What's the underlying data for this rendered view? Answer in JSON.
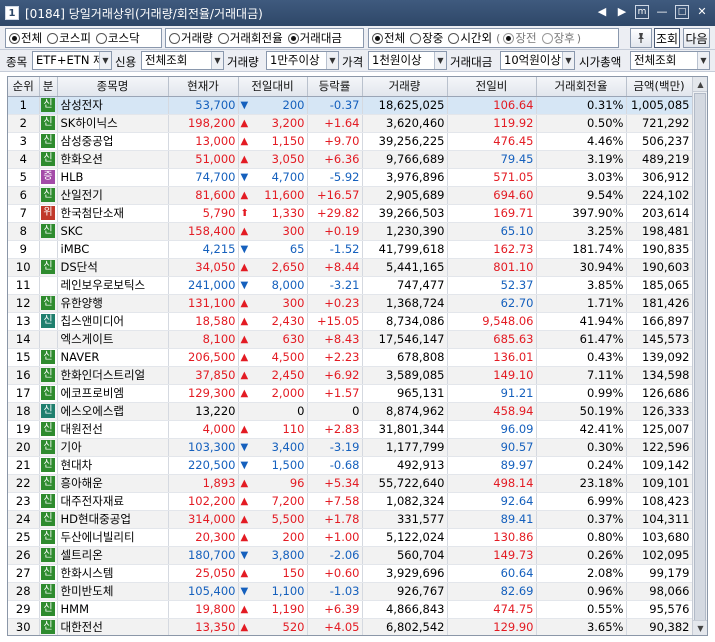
{
  "window": {
    "number": "1",
    "title": "[0184] 당일거래상위(거래량/회전율/거래대금)",
    "buttons": [
      "◀",
      "▶",
      "m",
      "—",
      "□",
      "✕"
    ]
  },
  "filters": {
    "market": {
      "options": [
        "전체",
        "코스피",
        "코스닥"
      ],
      "selected": "전체"
    },
    "sort": {
      "options": [
        "거래량",
        "거래회전율",
        "거래대금"
      ],
      "selected": "거래대금"
    },
    "session": {
      "options": [
        "전체",
        "장중",
        "시간외"
      ],
      "selected": "전체"
    },
    "after_hours": {
      "options": [
        "장전",
        "장후"
      ],
      "open": "(",
      "close": ")"
    },
    "pin_icon": "pin-icon",
    "search_button": "조회",
    "next_button": "다음",
    "row2": {
      "item_label": "종목",
      "item_value": "ETF+ETN 제",
      "credit_label": "신용",
      "credit_value": "전체조회",
      "volume_label": "거래량",
      "volume_value": "1만주이상",
      "price_label": "가격",
      "price_value": "1천원이상",
      "amount_label": "거래대금",
      "amount_value": "10억원이상",
      "cap_label": "시가총액",
      "cap_value": "전체조회"
    }
  },
  "table": {
    "headers": [
      "순위",
      "분",
      "종목명",
      "현재가",
      "전일대비",
      "등락률",
      "거래량",
      "전일비",
      "거래회전율",
      "금액(백만)"
    ],
    "rows": [
      {
        "rank": "1",
        "badge": "신",
        "badge_color": "green",
        "name": "삼성전자",
        "price": "53,700",
        "dir": "down",
        "change": "200",
        "rate": "-0.37",
        "volume": "18,625,025",
        "prev_ratio": "106.64",
        "turnover": "0.31%",
        "amount": "1,005,085",
        "selected": true
      },
      {
        "rank": "2",
        "badge": "신",
        "badge_color": "green",
        "name": "SK하이닉스",
        "price": "198,200",
        "dir": "up",
        "change": "3,200",
        "rate": "+1.64",
        "volume": "3,620,460",
        "prev_ratio": "119.92",
        "turnover": "0.50%",
        "amount": "721,292"
      },
      {
        "rank": "3",
        "badge": "신",
        "badge_color": "green",
        "name": "삼성중공업",
        "price": "13,000",
        "dir": "up",
        "change": "1,150",
        "rate": "+9.70",
        "volume": "39,256,225",
        "prev_ratio": "476.45",
        "turnover": "4.46%",
        "amount": "506,237"
      },
      {
        "rank": "4",
        "badge": "신",
        "badge_color": "green",
        "name": "한화오션",
        "price": "51,000",
        "dir": "up",
        "change": "3,050",
        "rate": "+6.36",
        "volume": "9,766,689",
        "prev_ratio": "79.45",
        "turnover": "3.19%",
        "amount": "489,219"
      },
      {
        "rank": "5",
        "badge": "증",
        "badge_color": "purple",
        "name": "HLB",
        "price": "74,700",
        "dir": "down",
        "change": "4,700",
        "rate": "-5.92",
        "volume": "3,976,896",
        "prev_ratio": "571.05",
        "turnover": "3.03%",
        "amount": "306,912"
      },
      {
        "rank": "6",
        "badge": "신",
        "badge_color": "green",
        "name": "산일전기",
        "price": "81,600",
        "dir": "up",
        "change": "11,600",
        "rate": "+16.57",
        "volume": "2,905,689",
        "prev_ratio": "694.60",
        "turnover": "9.54%",
        "amount": "224,102"
      },
      {
        "rank": "7",
        "badge": "위",
        "badge_color": "red",
        "name": "한국첨단소재",
        "price": "5,790",
        "dir": "limit",
        "change": "1,330",
        "rate": "+29.82",
        "volume": "39,266,503",
        "prev_ratio": "169.71",
        "turnover": "397.90%",
        "amount": "203,614"
      },
      {
        "rank": "8",
        "badge": "신",
        "badge_color": "green",
        "name": "SKC",
        "price": "158,400",
        "dir": "up",
        "change": "300",
        "rate": "+0.19",
        "volume": "1,230,390",
        "prev_ratio": "65.10",
        "turnover": "3.25%",
        "amount": "198,481"
      },
      {
        "rank": "9",
        "badge": "",
        "badge_color": "",
        "name": "iMBC",
        "price": "4,215",
        "dir": "down",
        "change": "65",
        "rate": "-1.52",
        "volume": "41,799,618",
        "prev_ratio": "162.73",
        "turnover": "181.74%",
        "amount": "190,835"
      },
      {
        "rank": "10",
        "badge": "신",
        "badge_color": "green",
        "name": "DS단석",
        "price": "34,050",
        "dir": "up",
        "change": "2,650",
        "rate": "+8.44",
        "volume": "5,441,165",
        "prev_ratio": "801.10",
        "turnover": "30.94%",
        "amount": "190,603"
      },
      {
        "rank": "11",
        "badge": "",
        "badge_color": "",
        "name": "레인보우로보틱스",
        "price": "241,000",
        "dir": "down",
        "change": "8,000",
        "rate": "-3.21",
        "volume": "747,477",
        "prev_ratio": "52.37",
        "turnover": "3.85%",
        "amount": "185,065"
      },
      {
        "rank": "12",
        "badge": "신",
        "badge_color": "green",
        "name": "유한양행",
        "price": "131,100",
        "dir": "up",
        "change": "300",
        "rate": "+0.23",
        "volume": "1,368,724",
        "prev_ratio": "62.70",
        "turnover": "1.71%",
        "amount": "181,426"
      },
      {
        "rank": "13",
        "badge": "신",
        "badge_color": "teal",
        "name": "칩스앤미디어",
        "price": "18,580",
        "dir": "up",
        "change": "2,430",
        "rate": "+15.05",
        "volume": "8,734,086",
        "prev_ratio": "9,548.06",
        "turnover": "41.94%",
        "amount": "166,897"
      },
      {
        "rank": "14",
        "badge": "",
        "badge_color": "",
        "name": "엑스게이트",
        "price": "8,100",
        "dir": "up",
        "change": "630",
        "rate": "+8.43",
        "volume": "17,546,147",
        "prev_ratio": "685.63",
        "turnover": "61.47%",
        "amount": "145,573"
      },
      {
        "rank": "15",
        "badge": "신",
        "badge_color": "green",
        "name": "NAVER",
        "price": "206,500",
        "dir": "up",
        "change": "4,500",
        "rate": "+2.23",
        "volume": "678,808",
        "prev_ratio": "136.01",
        "turnover": "0.43%",
        "amount": "139,092"
      },
      {
        "rank": "16",
        "badge": "신",
        "badge_color": "green",
        "name": "한화인더스트리얼",
        "price": "37,850",
        "dir": "up",
        "change": "2,450",
        "rate": "+6.92",
        "volume": "3,589,085",
        "prev_ratio": "149.10",
        "turnover": "7.11%",
        "amount": "134,598"
      },
      {
        "rank": "17",
        "badge": "신",
        "badge_color": "green",
        "name": "에코프로비엠",
        "price": "129,300",
        "dir": "up",
        "change": "2,000",
        "rate": "+1.57",
        "volume": "965,131",
        "prev_ratio": "91.21",
        "turnover": "0.99%",
        "amount": "126,686"
      },
      {
        "rank": "18",
        "badge": "신",
        "badge_color": "teal",
        "name": "에스오에스랩",
        "price": "13,220",
        "dir": "flat",
        "change": "0",
        "rate": "0",
        "volume": "8,874,962",
        "prev_ratio": "458.94",
        "turnover": "50.19%",
        "amount": "126,333"
      },
      {
        "rank": "19",
        "badge": "신",
        "badge_color": "green",
        "name": "대원전선",
        "price": "4,000",
        "dir": "up",
        "change": "110",
        "rate": "+2.83",
        "volume": "31,801,344",
        "prev_ratio": "96.09",
        "turnover": "42.41%",
        "amount": "125,007"
      },
      {
        "rank": "20",
        "badge": "신",
        "badge_color": "green",
        "name": "기아",
        "price": "103,300",
        "dir": "down",
        "change": "3,400",
        "rate": "-3.19",
        "volume": "1,177,799",
        "prev_ratio": "90.57",
        "turnover": "0.30%",
        "amount": "122,596"
      },
      {
        "rank": "21",
        "badge": "신",
        "badge_color": "green",
        "name": "현대차",
        "price": "220,500",
        "dir": "down",
        "change": "1,500",
        "rate": "-0.68",
        "volume": "492,913",
        "prev_ratio": "89.97",
        "turnover": "0.24%",
        "amount": "109,142"
      },
      {
        "rank": "22",
        "badge": "신",
        "badge_color": "green",
        "name": "흥아해운",
        "price": "1,893",
        "dir": "up",
        "change": "96",
        "rate": "+5.34",
        "volume": "55,722,640",
        "prev_ratio": "498.14",
        "turnover": "23.18%",
        "amount": "109,101"
      },
      {
        "rank": "23",
        "badge": "신",
        "badge_color": "green",
        "name": "대주전자재료",
        "price": "102,200",
        "dir": "up",
        "change": "7,200",
        "rate": "+7.58",
        "volume": "1,082,324",
        "prev_ratio": "92.64",
        "turnover": "6.99%",
        "amount": "108,423"
      },
      {
        "rank": "24",
        "badge": "신",
        "badge_color": "green",
        "name": "HD현대중공업",
        "price": "314,000",
        "dir": "up",
        "change": "5,500",
        "rate": "+1.78",
        "volume": "331,577",
        "prev_ratio": "89.41",
        "turnover": "0.37%",
        "amount": "104,311"
      },
      {
        "rank": "25",
        "badge": "신",
        "badge_color": "green",
        "name": "두산에너빌리티",
        "price": "20,300",
        "dir": "up",
        "change": "200",
        "rate": "+1.00",
        "volume": "5,122,024",
        "prev_ratio": "130.86",
        "turnover": "0.80%",
        "amount": "103,680"
      },
      {
        "rank": "26",
        "badge": "신",
        "badge_color": "green",
        "name": "셀트리온",
        "price": "180,700",
        "dir": "down",
        "change": "3,800",
        "rate": "-2.06",
        "volume": "560,704",
        "prev_ratio": "149.73",
        "turnover": "0.26%",
        "amount": "102,095"
      },
      {
        "rank": "27",
        "badge": "신",
        "badge_color": "green",
        "name": "한화시스템",
        "price": "25,050",
        "dir": "up",
        "change": "150",
        "rate": "+0.60",
        "volume": "3,929,696",
        "prev_ratio": "60.64",
        "turnover": "2.08%",
        "amount": "99,179"
      },
      {
        "rank": "28",
        "badge": "신",
        "badge_color": "green",
        "name": "한미반도체",
        "price": "105,400",
        "dir": "down",
        "change": "1,100",
        "rate": "-1.03",
        "volume": "926,767",
        "prev_ratio": "82.69",
        "turnover": "0.96%",
        "amount": "98,066"
      },
      {
        "rank": "29",
        "badge": "신",
        "badge_color": "green",
        "name": "HMM",
        "price": "19,800",
        "dir": "up",
        "change": "1,190",
        "rate": "+6.39",
        "volume": "4,866,843",
        "prev_ratio": "474.75",
        "turnover": "0.55%",
        "amount": "95,576"
      },
      {
        "rank": "30",
        "badge": "신",
        "badge_color": "green",
        "name": "대한전선",
        "price": "13,350",
        "dir": "up",
        "change": "520",
        "rate": "+4.05",
        "volume": "6,802,542",
        "prev_ratio": "129.90",
        "turnover": "3.65%",
        "amount": "90,382"
      }
    ]
  },
  "colors": {
    "up": "#e31b23",
    "down": "#1560bd",
    "green_badge": "#2e8b2e",
    "teal_badge": "#1f7f6e",
    "purple_badge": "#a34aa8",
    "red_badge": "#c0392b"
  }
}
